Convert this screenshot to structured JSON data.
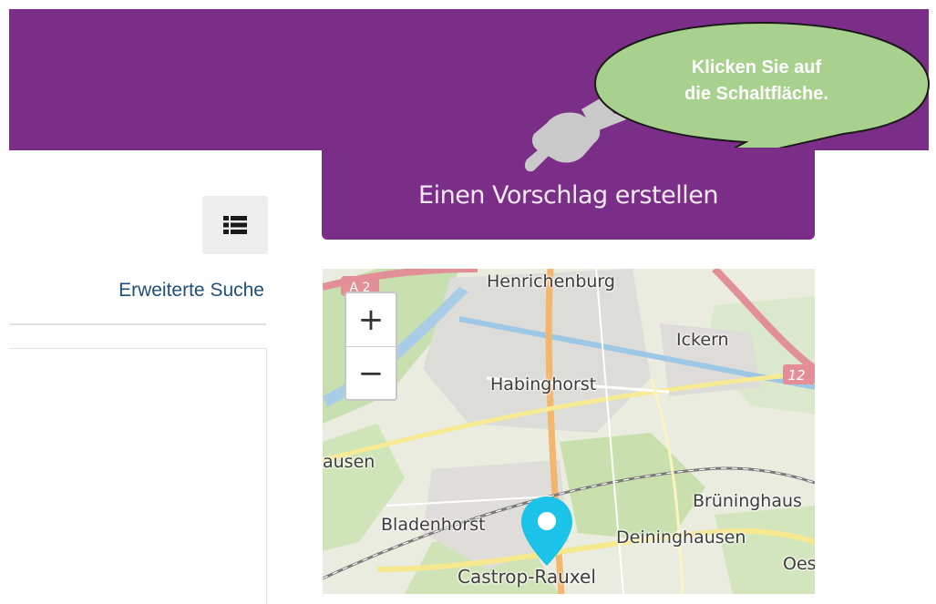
{
  "header": {
    "background": "#7b2e87"
  },
  "toolbar": {
    "list_view_icon": "list-view-icon",
    "advanced_search_label": "Erweiterte Suche"
  },
  "proposal": {
    "button_label": "Einen Vorschlag erstellen"
  },
  "callout": {
    "line1": "Klicken Sie auf",
    "line2": "die Schaltfläche.",
    "color": "#a9d18e"
  },
  "map": {
    "zoom_in": "+",
    "zoom_out": "−",
    "road_badges": [
      "A 2",
      "12"
    ],
    "places": [
      "Henrichenburg",
      "Ickern",
      "Habinghorst",
      "ausen",
      "Brüninghaus",
      "Bladenhorst",
      "Deininghausen",
      "Oes",
      "Castrop-Rauxel"
    ],
    "marker_color": "#1cc3e8"
  },
  "icons": {
    "pointer": "pointing-hand-icon",
    "marker": "map-marker-icon"
  }
}
